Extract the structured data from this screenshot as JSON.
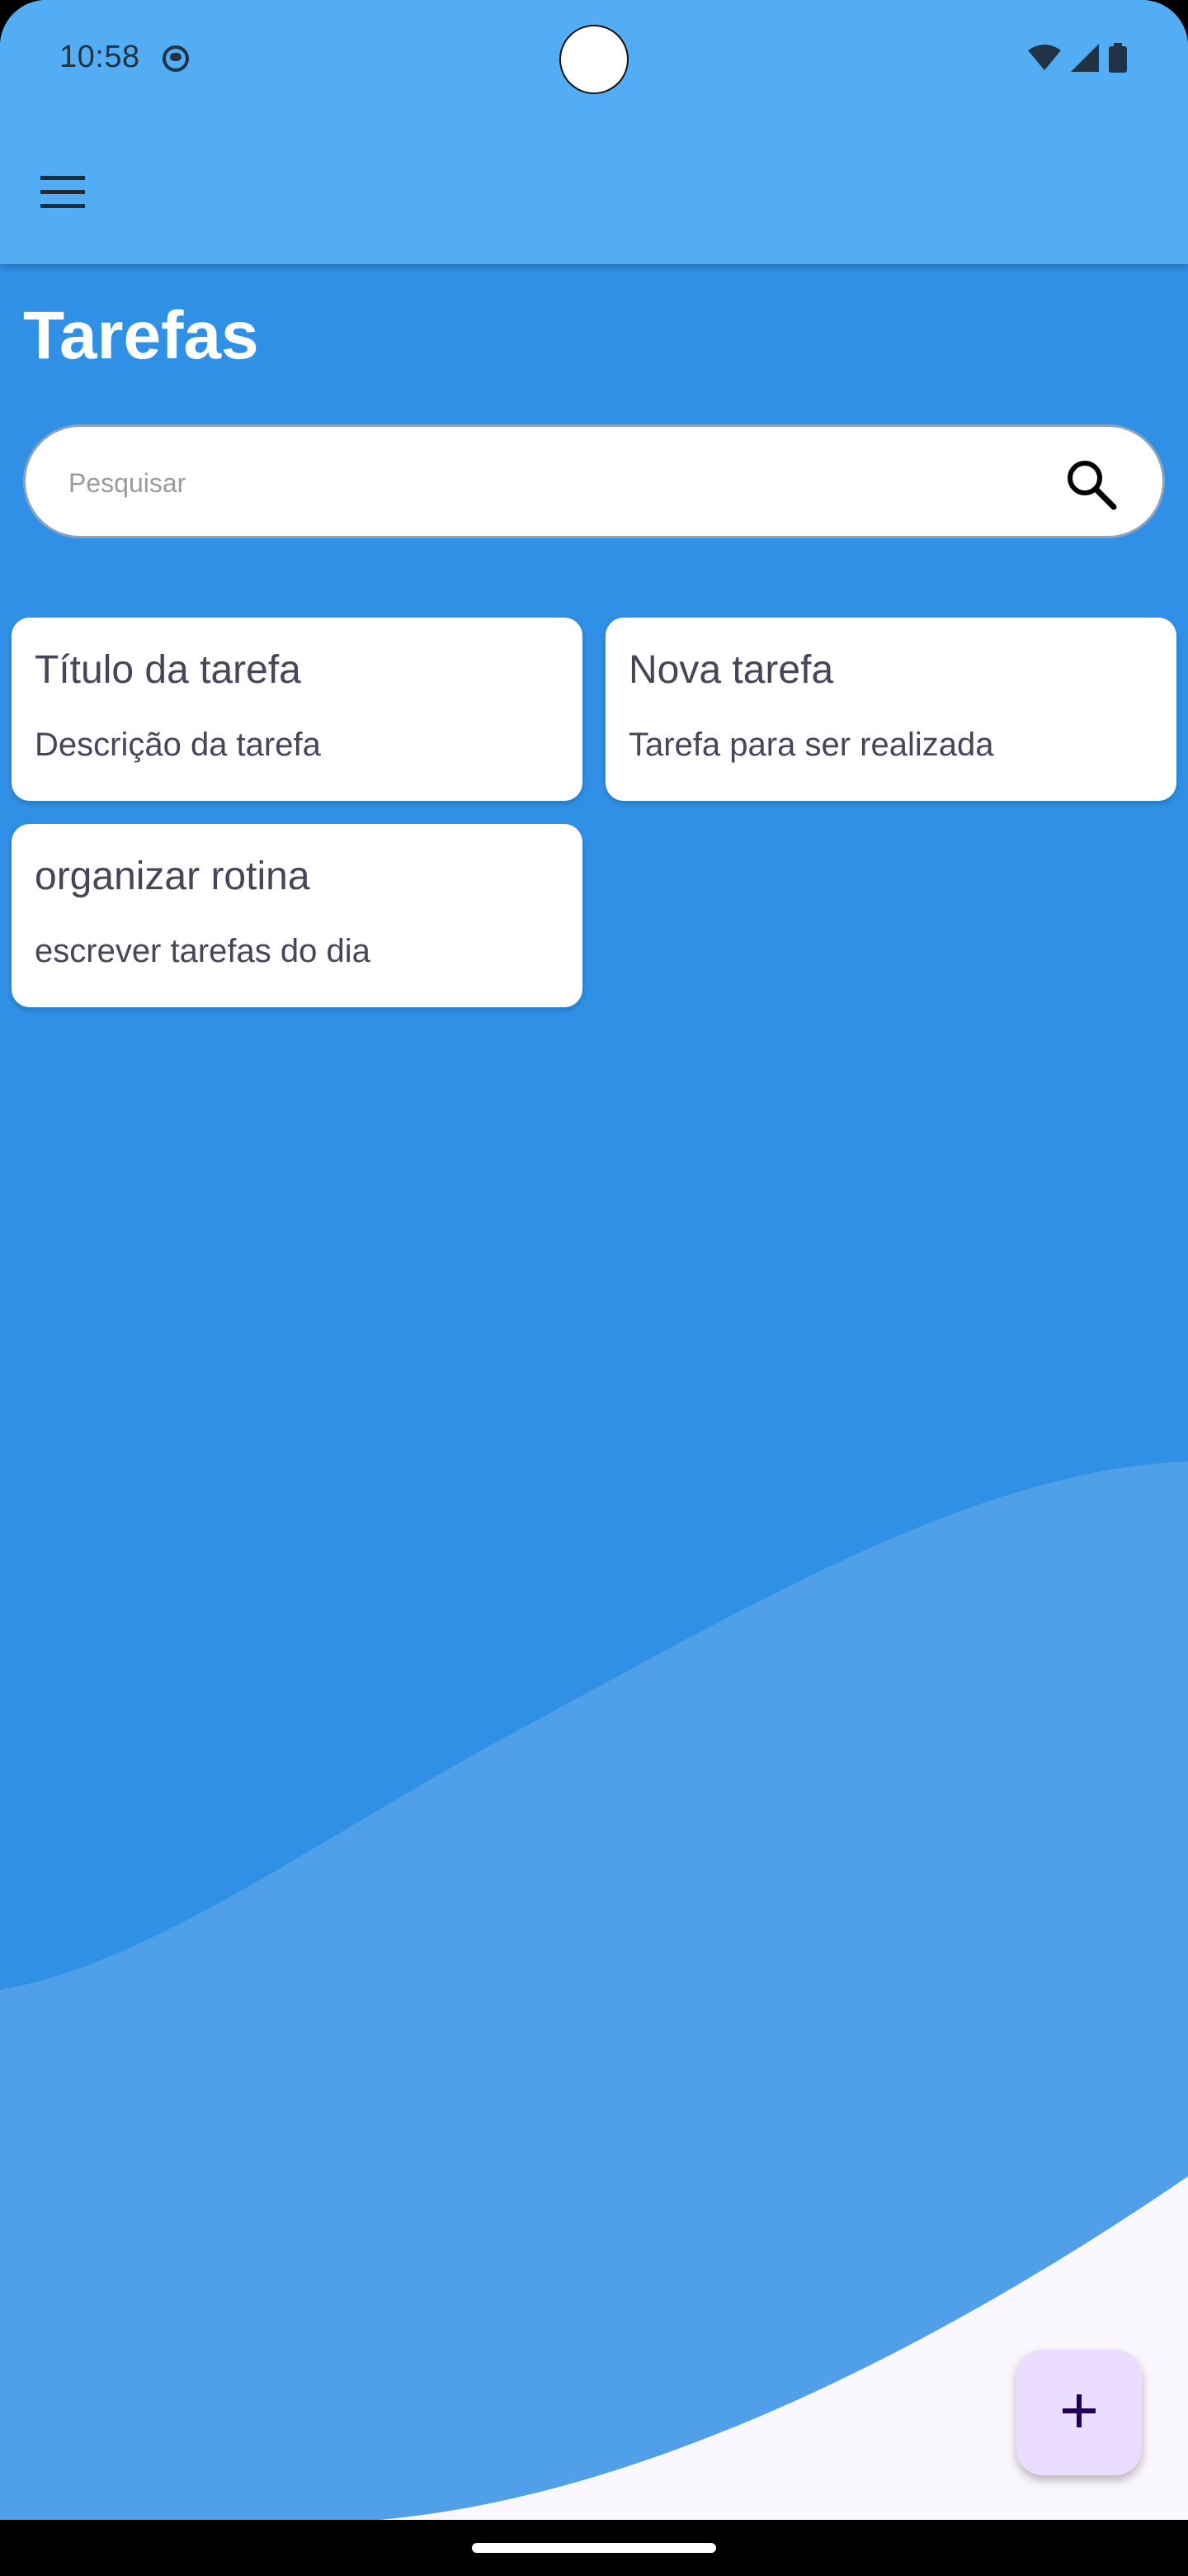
{
  "status_bar": {
    "time": "10:58",
    "icons": [
      "app-notification-icon",
      "wifi-icon",
      "cellular-signal-icon",
      "battery-icon"
    ]
  },
  "app_bar": {
    "menu_icon": "hamburger-menu-icon"
  },
  "page": {
    "title": "Tarefas"
  },
  "search": {
    "placeholder": "Pesquisar",
    "value": "",
    "icon": "search-icon"
  },
  "tasks": [
    {
      "title": "Título da tarefa",
      "description": "Descrição da tarefa"
    },
    {
      "title": "Nova tarefa",
      "description": "Tarefa para ser realizada"
    },
    {
      "title": "organizar rotina",
      "description": "escrever tarefas do dia"
    }
  ],
  "fab": {
    "icon": "plus-icon"
  },
  "colors": {
    "app_bar": "#53ADF5",
    "background": "#3090E6",
    "wave": "#4FA0E8",
    "bottom_surface": "#FBF8FD",
    "card": "#FFFFFF",
    "card_text": "#4A4458",
    "fab": "#EADDFF",
    "fab_icon": "#21005D"
  }
}
